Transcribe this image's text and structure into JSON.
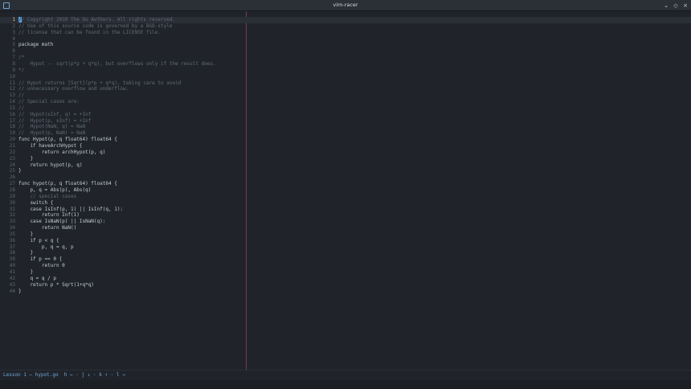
{
  "window": {
    "title": "vim-racer"
  },
  "colors": {
    "accent": "#5aa0d8",
    "colorcolumn": "#7a3c48",
    "comment": "#616a78"
  },
  "status": {
    "text": "Lesson 1 — hypot.go  h ← · j ↓ · k ↑ · l →"
  },
  "code": [
    {
      "n": "1",
      "t": "// Copyright 2010 The Go Authors. All rights reserved.",
      "c": true,
      "cur": true
    },
    {
      "n": "2",
      "t": "// Use of this source code is governed by a BSD-style",
      "c": true
    },
    {
      "n": "3",
      "t": "// license that can be found in the LICENSE file.",
      "c": true
    },
    {
      "n": "4",
      "t": ""
    },
    {
      "n": "5",
      "t": "package math"
    },
    {
      "n": "6",
      "t": ""
    },
    {
      "n": "7",
      "t": "/*",
      "c": true
    },
    {
      "n": "8",
      "t": "    Hypot -- sqrt(p*p + q*q), but overflows only if the result does.",
      "c": true
    },
    {
      "n": "9",
      "t": "*/",
      "c": true
    },
    {
      "n": "10",
      "t": ""
    },
    {
      "n": "11",
      "t": "// Hypot returns [Sqrt](p*p + q*q), taking care to avoid",
      "c": true
    },
    {
      "n": "12",
      "t": "// unnecessary overflow and underflow.",
      "c": true
    },
    {
      "n": "13",
      "t": "//",
      "c": true
    },
    {
      "n": "14",
      "t": "// Special cases are:",
      "c": true
    },
    {
      "n": "15",
      "t": "//",
      "c": true
    },
    {
      "n": "16",
      "t": "//  Hypot(±Inf, q) = +Inf",
      "c": true
    },
    {
      "n": "17",
      "t": "//  Hypot(p, ±Inf) = +Inf",
      "c": true
    },
    {
      "n": "18",
      "t": "//  Hypot(NaN, q) = NaN",
      "c": true
    },
    {
      "n": "19",
      "t": "//  Hypot(p, NaN) = NaN",
      "c": true
    },
    {
      "n": "20",
      "t": "func Hypot(p, q float64) float64 {"
    },
    {
      "n": "21",
      "t": "    if haveArchHypot {"
    },
    {
      "n": "22",
      "t": "        return archHypot(p, q)"
    },
    {
      "n": "23",
      "t": "    }"
    },
    {
      "n": "24",
      "t": "    return hypot(p, q)"
    },
    {
      "n": "25",
      "t": "}"
    },
    {
      "n": "26",
      "t": ""
    },
    {
      "n": "27",
      "t": "func hypot(p, q float64) float64 {"
    },
    {
      "n": "28",
      "t": "    p, q = Abs(p), Abs(q)"
    },
    {
      "n": "29",
      "t": "    // special cases",
      "c": true
    },
    {
      "n": "30",
      "t": "    switch {"
    },
    {
      "n": "31",
      "t": "    case IsInf(p, 1) || IsInf(q, 1):"
    },
    {
      "n": "32",
      "t": "        return Inf(1)"
    },
    {
      "n": "33",
      "t": "    case IsNaN(p) || IsNaN(q):"
    },
    {
      "n": "34",
      "t": "        return NaN()"
    },
    {
      "n": "35",
      "t": "    }"
    },
    {
      "n": "36",
      "t": "    if p < q {"
    },
    {
      "n": "37",
      "t": "        p, q = q, p"
    },
    {
      "n": "38",
      "t": "    }"
    },
    {
      "n": "39",
      "t": "    if p == 0 {"
    },
    {
      "n": "40",
      "t": "        return 0"
    },
    {
      "n": "41",
      "t": "    }"
    },
    {
      "n": "42",
      "t": "    q = q / p"
    },
    {
      "n": "43",
      "t": "    return p * Sqrt(1+q*q)"
    },
    {
      "n": "44",
      "t": "}"
    }
  ]
}
